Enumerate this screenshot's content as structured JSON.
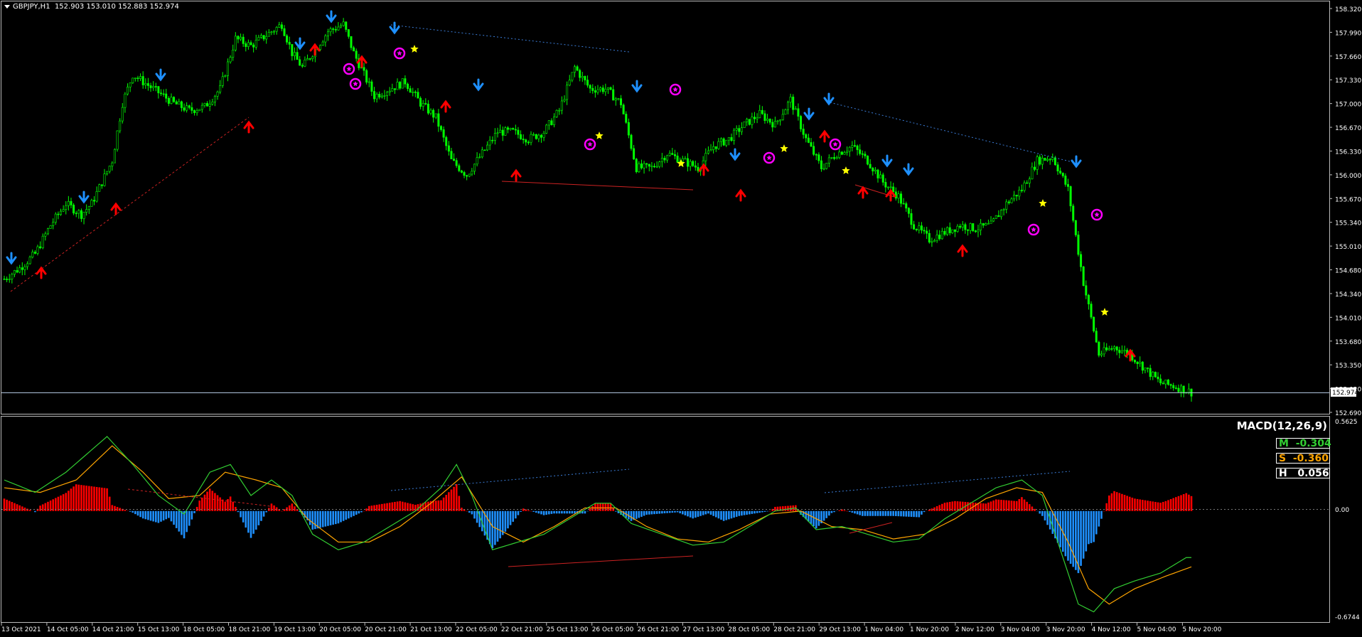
{
  "header": {
    "symbol": "GBPJPY,H1",
    "ohlc": "152.903 153.010 152.883 152.974"
  },
  "price_axis": {
    "labels": [
      "158.320",
      "157.990",
      "157.660",
      "157.330",
      "157.000",
      "156.670",
      "156.330",
      "156.000",
      "155.670",
      "155.340",
      "155.010",
      "154.680",
      "154.340",
      "154.010",
      "153.680",
      "153.350",
      "153.020",
      "152.690"
    ],
    "current": "152.974"
  },
  "macd": {
    "title": "MACD(12,26,9)",
    "axis_top": "0.5625",
    "axis_zero": "0.00",
    "axis_bottom": "-0.6744",
    "main_label": "M",
    "main_value": "-0.304",
    "signal_label": "S",
    "signal_value": "-0.360",
    "hist_label": "H",
    "hist_value": "0.056"
  },
  "time_axis": [
    "13 Oct 2021",
    "14 Oct 05:00",
    "14 Oct 21:00",
    "15 Oct 13:00",
    "18 Oct 05:00",
    "18 Oct 21:00",
    "19 Oct 13:00",
    "20 Oct 05:00",
    "20 Oct 21:00",
    "21 Oct 13:00",
    "22 Oct 05:00",
    "22 Oct 21:00",
    "25 Oct 13:00",
    "26 Oct 05:00",
    "26 Oct 21:00",
    "27 Oct 13:00",
    "28 Oct 05:00",
    "28 Oct 21:00",
    "29 Oct 13:00",
    "1 Nov 04:00",
    "1 Nov 20:00",
    "2 Nov 12:00",
    "3 Nov 04:00",
    "3 Nov 20:00",
    "4 Nov 12:00",
    "5 Nov 04:00",
    "5 Nov 20:00"
  ],
  "colors": {
    "background": "#000000",
    "candles": "#00ff00",
    "down_arrow": "#1e90ff",
    "up_arrow": "#ff0000",
    "star": "#ffff00",
    "circle_star": "#ff00ff",
    "macd_main": "#32cd32",
    "macd_signal": "#ffa500",
    "hist_pos": "#ff0000",
    "hist_neg": "#1e90ff"
  },
  "chart_data": {
    "type": "candlestick",
    "price_range": [
      152.69,
      158.32
    ],
    "close_path": [
      [
        0,
        154.55
      ],
      [
        6,
        154.7
      ],
      [
        12,
        154.9
      ],
      [
        18,
        155.3
      ],
      [
        24,
        155.6
      ],
      [
        30,
        155.45
      ],
      [
        34,
        155.6
      ],
      [
        38,
        155.9
      ],
      [
        42,
        156.2
      ],
      [
        46,
        157.0
      ],
      [
        50,
        157.4
      ],
      [
        54,
        157.3
      ],
      [
        58,
        157.2
      ],
      [
        62,
        157.1
      ],
      [
        66,
        157.0
      ],
      [
        72,
        156.9
      ],
      [
        78,
        156.95
      ],
      [
        84,
        157.2
      ],
      [
        90,
        157.9
      ],
      [
        96,
        157.8
      ],
      [
        102,
        157.95
      ],
      [
        108,
        158.1
      ],
      [
        112,
        157.7
      ],
      [
        116,
        157.5
      ],
      [
        120,
        157.7
      ],
      [
        126,
        158.0
      ],
      [
        132,
        158.1
      ],
      [
        136,
        157.7
      ],
      [
        140,
        157.4
      ],
      [
        144,
        157.1
      ],
      [
        150,
        157.2
      ],
      [
        156,
        157.3
      ],
      [
        162,
        157.0
      ],
      [
        168,
        156.8
      ],
      [
        174,
        156.2
      ],
      [
        180,
        156.0
      ],
      [
        186,
        156.3
      ],
      [
        192,
        156.6
      ],
      [
        198,
        156.6
      ],
      [
        204,
        156.5
      ],
      [
        210,
        156.6
      ],
      [
        216,
        156.9
      ],
      [
        222,
        157.5
      ],
      [
        228,
        157.2
      ],
      [
        234,
        157.2
      ],
      [
        240,
        157.0
      ],
      [
        246,
        156.1
      ],
      [
        252,
        156.1
      ],
      [
        258,
        156.3
      ],
      [
        264,
        156.2
      ],
      [
        270,
        156.1
      ],
      [
        276,
        156.4
      ],
      [
        282,
        156.5
      ],
      [
        288,
        156.7
      ],
      [
        294,
        156.85
      ],
      [
        300,
        156.7
      ],
      [
        306,
        157.05
      ],
      [
        312,
        156.5
      ],
      [
        318,
        156.1
      ],
      [
        324,
        156.3
      ],
      [
        330,
        156.4
      ],
      [
        336,
        156.2
      ],
      [
        342,
        155.9
      ],
      [
        348,
        155.7
      ],
      [
        354,
        155.3
      ],
      [
        360,
        155.1
      ],
      [
        366,
        155.2
      ],
      [
        372,
        155.3
      ],
      [
        378,
        155.25
      ],
      [
        384,
        155.3
      ],
      [
        390,
        155.6
      ],
      [
        396,
        155.8
      ],
      [
        402,
        156.2
      ],
      [
        408,
        156.25
      ],
      [
        414,
        155.8
      ],
      [
        420,
        154.5
      ],
      [
        426,
        153.5
      ],
      [
        432,
        153.6
      ],
      [
        438,
        153.5
      ],
      [
        444,
        153.3
      ],
      [
        450,
        153.1
      ],
      [
        456,
        153.05
      ],
      [
        462,
        152.97
      ]
    ],
    "macd_main_path": [
      [
        0,
        0.2
      ],
      [
        12,
        0.12
      ],
      [
        24,
        0.25
      ],
      [
        40,
        0.48
      ],
      [
        50,
        0.3
      ],
      [
        60,
        0.1
      ],
      [
        70,
        -0.02
      ],
      [
        80,
        0.25
      ],
      [
        88,
        0.3
      ],
      [
        96,
        0.1
      ],
      [
        104,
        0.2
      ],
      [
        112,
        0.1
      ],
      [
        120,
        -0.15
      ],
      [
        130,
        -0.25
      ],
      [
        140,
        -0.2
      ],
      [
        150,
        -0.1
      ],
      [
        160,
        0.0
      ],
      [
        170,
        0.15
      ],
      [
        176,
        0.3
      ],
      [
        182,
        0.1
      ],
      [
        190,
        -0.25
      ],
      [
        200,
        -0.2
      ],
      [
        210,
        -0.15
      ],
      [
        220,
        -0.05
      ],
      [
        230,
        0.05
      ],
      [
        236,
        0.05
      ],
      [
        244,
        -0.08
      ],
      [
        256,
        -0.15
      ],
      [
        268,
        -0.22
      ],
      [
        280,
        -0.2
      ],
      [
        290,
        -0.1
      ],
      [
        300,
        0.0
      ],
      [
        308,
        0.02
      ],
      [
        316,
        -0.12
      ],
      [
        326,
        -0.1
      ],
      [
        336,
        -0.15
      ],
      [
        346,
        -0.2
      ],
      [
        356,
        -0.18
      ],
      [
        366,
        -0.05
      ],
      [
        376,
        0.05
      ],
      [
        386,
        0.15
      ],
      [
        396,
        0.2
      ],
      [
        404,
        0.1
      ],
      [
        412,
        -0.3
      ],
      [
        418,
        -0.6
      ],
      [
        424,
        -0.65
      ],
      [
        432,
        -0.5
      ],
      [
        440,
        -0.45
      ],
      [
        450,
        -0.4
      ],
      [
        460,
        -0.3
      ]
    ],
    "macd_signal_path": [
      [
        0,
        0.15
      ],
      [
        14,
        0.12
      ],
      [
        28,
        0.2
      ],
      [
        42,
        0.42
      ],
      [
        54,
        0.25
      ],
      [
        64,
        0.08
      ],
      [
        76,
        0.1
      ],
      [
        86,
        0.25
      ],
      [
        98,
        0.2
      ],
      [
        108,
        0.15
      ],
      [
        118,
        -0.05
      ],
      [
        130,
        -0.2
      ],
      [
        142,
        -0.2
      ],
      [
        154,
        -0.1
      ],
      [
        166,
        0.05
      ],
      [
        178,
        0.22
      ],
      [
        190,
        -0.1
      ],
      [
        202,
        -0.2
      ],
      [
        214,
        -0.1
      ],
      [
        226,
        0.02
      ],
      [
        238,
        0.02
      ],
      [
        250,
        -0.1
      ],
      [
        262,
        -0.18
      ],
      [
        274,
        -0.2
      ],
      [
        286,
        -0.12
      ],
      [
        298,
        -0.02
      ],
      [
        310,
        0.0
      ],
      [
        322,
        -0.1
      ],
      [
        334,
        -0.12
      ],
      [
        346,
        -0.18
      ],
      [
        358,
        -0.15
      ],
      [
        370,
        -0.05
      ],
      [
        382,
        0.08
      ],
      [
        394,
        0.15
      ],
      [
        404,
        0.12
      ],
      [
        414,
        -0.2
      ],
      [
        422,
        -0.5
      ],
      [
        430,
        -0.6
      ],
      [
        440,
        -0.5
      ],
      [
        452,
        -0.42
      ],
      [
        462,
        -0.36
      ]
    ]
  }
}
